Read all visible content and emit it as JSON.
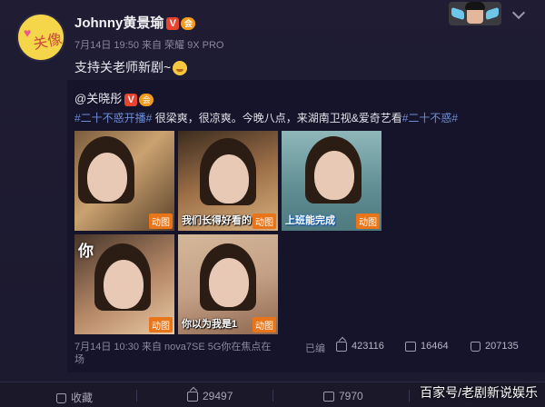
{
  "author": {
    "name": "Johnny黄景瑜",
    "verified": "V",
    "badge": "会",
    "avatar_text": "关像",
    "time_source": "7月14日 19:50 来自 荣耀 9X PRO",
    "content": "支持关老师新剧~"
  },
  "repost": {
    "user": "@关晓彤",
    "verified": "V",
    "badge": "会",
    "topic1": "#二十不惑开播#",
    "body": " 很梁爽，很凉爽。今晚八点，来湖南卫视&爱奇艺看",
    "topic2": "#二十不惑#",
    "gif_label": "动图",
    "thumbs": [
      {
        "subtitle": ""
      },
      {
        "subtitle": "我们长得好看的"
      },
      {
        "subtitle": "上班能完成"
      },
      {
        "subtitle": "",
        "big": "你"
      },
      {
        "subtitle": "你以为我是1"
      }
    ],
    "footer": "7月14日 10:30 来自 nova7SE 5G你在焦点在",
    "footer2": "场",
    "edit": "已编",
    "reposts": "423116",
    "comments": "16464",
    "likes": "207135"
  },
  "actions": {
    "favorite": "收藏",
    "repost": "29497",
    "comment": "7970"
  },
  "watermark": "百家号/老剧新说娱乐",
  "icons": [
    "share-icon",
    "comment-icon",
    "like-icon",
    "star-icon",
    "chevron-down-icon"
  ]
}
